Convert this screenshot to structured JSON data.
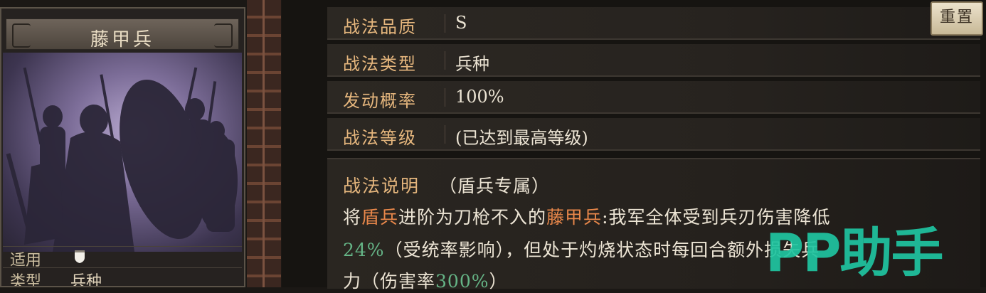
{
  "card": {
    "title": "藤甲兵",
    "rows": [
      {
        "key": "适用",
        "icon": "shield-icon"
      },
      {
        "key": "类型",
        "value": "兵种"
      }
    ]
  },
  "reset_button": "重置",
  "attributes": [
    {
      "label": "战法品质",
      "value": "S"
    },
    {
      "label": "战法类型",
      "value": "兵种"
    },
    {
      "label": "发动概率",
      "value": "100%"
    },
    {
      "label": "战法等级",
      "value": "(已达到最高等级)"
    }
  ],
  "description": {
    "label": "战法说明",
    "tag": "（盾兵专属）",
    "line1": {
      "p1": "将",
      "hl1": "盾兵",
      "p2": "进阶为刀枪不入的",
      "hl2": "藤甲兵",
      "p3": ":我军全体受到兵刃伤害降低"
    },
    "line2": {
      "num": "24%",
      "p1": "（受统率影响），但处于灼烧状态时每回合额外损失兵"
    },
    "line3": {
      "p1": "力（伤害率",
      "num": "300%",
      "p2": "）"
    }
  },
  "watermark": "PP助手",
  "colors": {
    "accent": "#e5b67d",
    "highlight": "#e8874a",
    "number": "#65b486",
    "watermark": "#1fc5a1"
  }
}
